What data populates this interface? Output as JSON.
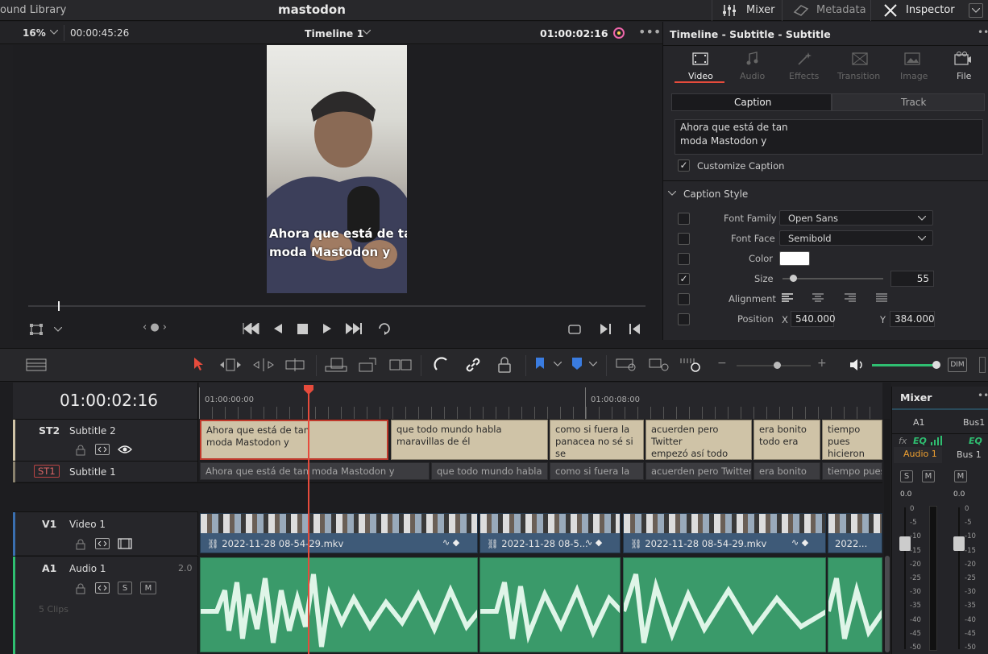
{
  "topbar": {
    "left_label": "ound Library",
    "project_title": "mastodon",
    "mixer_label": "Mixer",
    "metadata_label": "Metadata",
    "inspector_label": "Inspector"
  },
  "viewer_bar": {
    "zoom": "16%",
    "timecode_left": "00:00:45:26",
    "timeline_name": "Timeline 1",
    "timecode_right": "01:00:02:16"
  },
  "preview": {
    "caption_line1": "Ahora que está de tan",
    "caption_line2": "moda Mastodon y"
  },
  "inspector": {
    "title": "Timeline - Subtitle - Subtitle",
    "tabs": [
      {
        "label": "Video",
        "active": true
      },
      {
        "label": "Audio",
        "active": false
      },
      {
        "label": "Effects",
        "active": false
      },
      {
        "label": "Transition",
        "active": false
      },
      {
        "label": "Image",
        "active": false
      },
      {
        "label": "File",
        "active": false
      }
    ],
    "subtabs": {
      "caption": "Caption",
      "track": "Track"
    },
    "caption_text_line1": "Ahora que está de tan",
    "caption_text_line2": "moda Mastodon y",
    "customize_caption": "Customize Caption",
    "caption_style": "Caption Style",
    "font_family_label": "Font Family",
    "font_family": "Open Sans",
    "font_face_label": "Font Face",
    "font_face": "Semibold",
    "color_label": "Color",
    "color_value": "#ffffff",
    "size_label": "Size",
    "size": "55",
    "size_fraction": 0.1,
    "alignment_label": "Alignment",
    "position_label": "Position",
    "pos_x_label": "X",
    "pos_x": "540.000",
    "pos_y_label": "Y",
    "pos_y": "384.000"
  },
  "timeline": {
    "timecode": "01:00:02:16",
    "ruler": [
      "01:00:00:00",
      "01:00:08:00"
    ],
    "tracks": {
      "st2": {
        "id": "ST2",
        "name": "Subtitle 2"
      },
      "st1": {
        "id": "ST1",
        "name": "Subtitle 1"
      },
      "v1": {
        "id": "V1",
        "name": "Video 1"
      },
      "a1": {
        "id": "A1",
        "name": "Audio 1",
        "channels": "2.0",
        "clips": "5 Clips"
      }
    },
    "st2_clips": [
      {
        "l1": "Ahora que está de tan",
        "l2": "moda Mastodon y"
      },
      {
        "l1": "que todo mundo habla",
        "l2": "maravillas de él"
      },
      {
        "l1": "como si fuera la",
        "l2": "panacea no sé si se"
      },
      {
        "l1": "acuerden pero Twitter",
        "l2": "empezó así todo"
      },
      {
        "l1": "era bonito",
        "l2": "todo era"
      },
      {
        "l1": "tiempo pues",
        "l2": "hicieron"
      }
    ],
    "st1_clips": [
      "Ahora que está de tan moda Mastodon y",
      "que todo mundo habla",
      "como si fuera la",
      "acuerden pero Twitter",
      "era bonito",
      "tiempo pues"
    ],
    "video_clips": [
      "2022-11-28 08-54-29.mkv",
      "2022-11-28 08-5...",
      "2022-11-28 08-54-29.mkv",
      "2022..."
    ],
    "s_label": "S",
    "m_label": "M"
  },
  "mixer": {
    "title": "Mixer",
    "ch1": "A1",
    "ch2": "Bus1",
    "fx": "fx",
    "eq": "EQ",
    "ch1_name": "Audio 1",
    "ch2_name": "Bus 1",
    "s": "S",
    "m": "M",
    "level": "0.0",
    "scale": [
      "0",
      "-5",
      "-10",
      "-15",
      "-20",
      "-25",
      "-30",
      "-35",
      "-40",
      "-45",
      "-50"
    ]
  },
  "toolbar": {
    "dim": "DIM"
  },
  "colors": {
    "accent": "#e64b3c",
    "subtitle_clip": "#cfc3a7",
    "video_clip": "#3e5a78",
    "audio_clip": "#3a9a6a",
    "mixer_green": "#2fbf71"
  }
}
